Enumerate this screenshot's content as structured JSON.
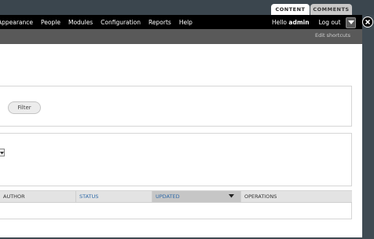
{
  "tabs": [
    {
      "label": "CONTENT",
      "active": true
    },
    {
      "label": "COMMENTS",
      "active": false
    }
  ],
  "toolbar": {
    "menu": [
      "Appearance",
      "People",
      "Modules",
      "Configuration",
      "Reports",
      "Help"
    ],
    "hello_prefix": "Hello ",
    "username": "admin",
    "logout": "Log out"
  },
  "shortcuts": {
    "edit_label": "Edit shortcuts"
  },
  "filter": {
    "button_label": "Filter"
  },
  "table": {
    "columns": [
      {
        "label": "AUTHOR",
        "sortable": false
      },
      {
        "label": "STATUS",
        "sortable": true
      },
      {
        "label": "UPDATED",
        "sortable": true,
        "active_sort": true
      },
      {
        "label": "OPERATIONS",
        "sortable": false
      }
    ]
  },
  "colors": {
    "toolbar": "#000000",
    "shortcut_bar": "#595959",
    "link": "#2f6aa8",
    "backdrop": "#3f4a52"
  }
}
